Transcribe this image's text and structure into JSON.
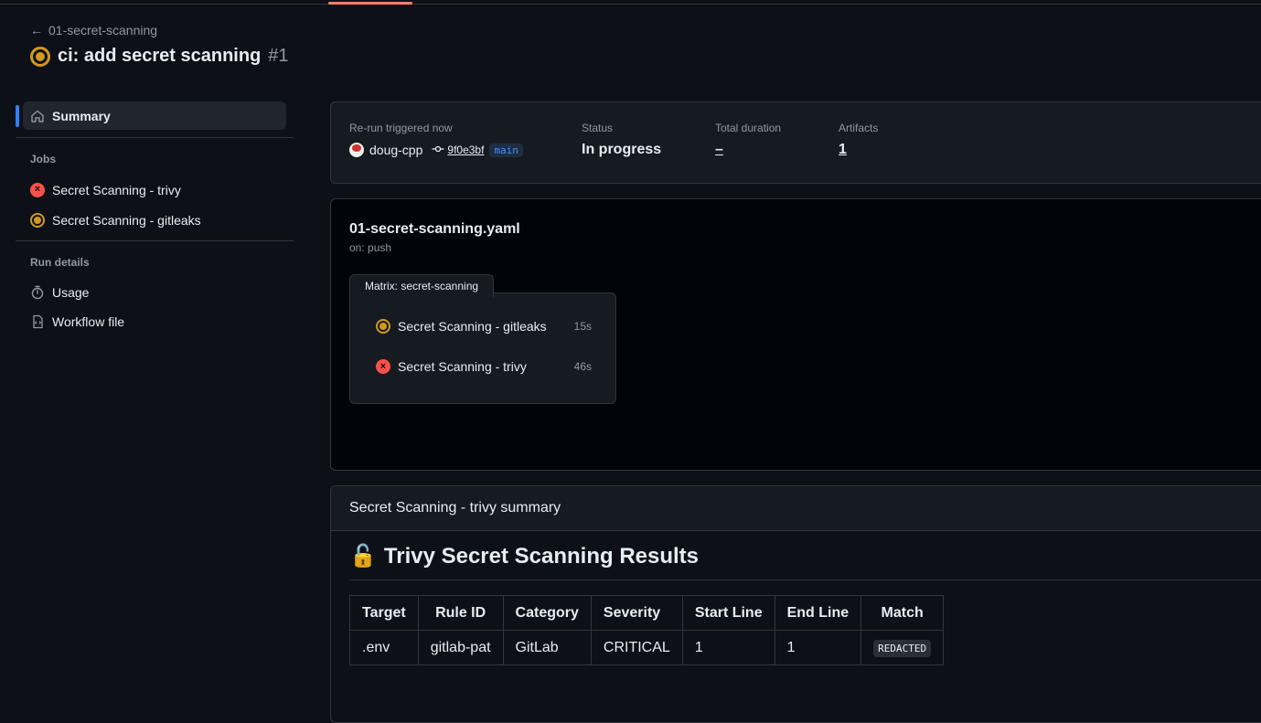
{
  "header": {
    "back_label": "01-secret-scanning",
    "run_title": "ci: add secret scanning",
    "run_number": "#1"
  },
  "sidebar": {
    "summary_label": "Summary",
    "jobs_heading": "Jobs",
    "jobs": [
      {
        "label": "Secret Scanning - trivy",
        "status": "failed"
      },
      {
        "label": "Secret Scanning - gitleaks",
        "status": "in_progress"
      }
    ],
    "run_details_heading": "Run details",
    "details": [
      {
        "label": "Usage",
        "icon": "stopwatch-icon"
      },
      {
        "label": "Workflow file",
        "icon": "file-code-icon"
      }
    ]
  },
  "run_meta": {
    "trigger_label": "Re-run triggered now",
    "actor": "doug-cpp",
    "commit": "9f0e3bf",
    "branch": "main",
    "status_label": "Status",
    "status_value": "In progress",
    "duration_label": "Total duration",
    "duration_value": "–",
    "artifacts_label": "Artifacts",
    "artifacts_value": "1"
  },
  "workflow": {
    "file_name": "01-secret-scanning.yaml",
    "trigger": "on: push",
    "matrix_label": "Matrix: secret-scanning",
    "jobs": [
      {
        "label": "Secret Scanning - gitleaks",
        "duration": "15s",
        "status": "in_progress"
      },
      {
        "label": "Secret Scanning - trivy",
        "duration": "46s",
        "status": "failed"
      }
    ]
  },
  "summary": {
    "header": "Secret Scanning - trivy summary",
    "title_emoji": "🔓",
    "title": "Trivy Secret Scanning Results",
    "columns": [
      "Target",
      "Rule ID",
      "Category",
      "Severity",
      "Start Line",
      "End Line",
      "Match"
    ],
    "rows": [
      {
        "target": ".env",
        "rule_id": "gitlab-pat",
        "category": "GitLab",
        "severity": "CRITICAL",
        "start_line": "1",
        "end_line": "1",
        "match": "REDACTED"
      }
    ]
  },
  "colors": {
    "background": "#0d1117",
    "accent": "#2f81f7",
    "in_progress": "#d29922",
    "failed": "#f85149",
    "tab_underline": "#f78166"
  }
}
